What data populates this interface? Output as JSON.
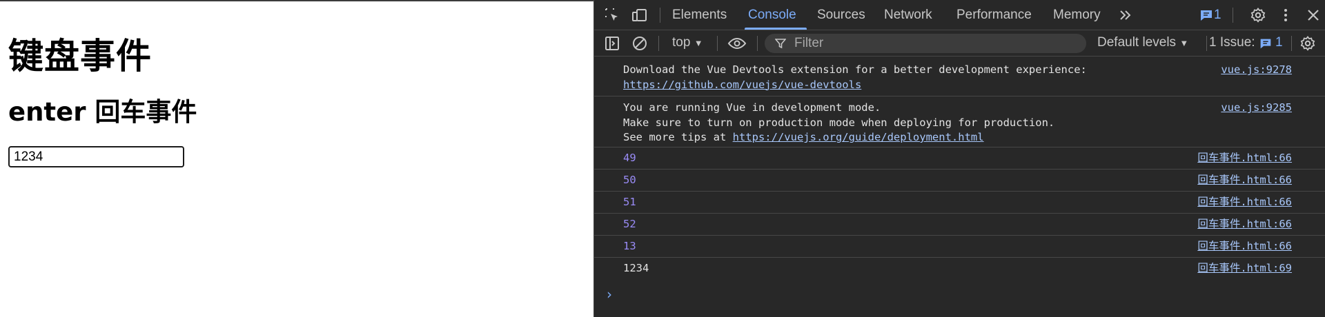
{
  "page": {
    "heading": "键盘事件",
    "subheading": "enter 回车事件",
    "input_value": "1234"
  },
  "devtools": {
    "tabs": [
      "Elements",
      "Console",
      "Sources",
      "Network",
      "Performance",
      "Memory"
    ],
    "active_tab": "Console",
    "issues_badge_count": "1",
    "toolbar": {
      "context": "top",
      "filter_placeholder": "Filter",
      "levels": "Default levels",
      "issues_label": "1 Issue:",
      "issues_count": "1"
    },
    "messages": [
      {
        "lines": [
          "Download the Vue Devtools extension for a better development experience:"
        ],
        "link": "https://github.com/vuejs/vue-devtools",
        "source": "vue.js:9278"
      },
      {
        "lines": [
          "You are running Vue in development mode.",
          "Make sure to turn on production mode when deploying for production.",
          "See more tips at "
        ],
        "link": "https://vuejs.org/guide/deployment.html",
        "source": "vue.js:9285"
      },
      {
        "text": "49",
        "source": "回车事件.html:66"
      },
      {
        "text": "50",
        "source": "回车事件.html:66"
      },
      {
        "text": "51",
        "source": "回车事件.html:66"
      },
      {
        "text": "52",
        "source": "回车事件.html:66"
      },
      {
        "text": "13",
        "source": "回车事件.html:66"
      },
      {
        "text": "1234",
        "source": "回车事件.html:69"
      }
    ],
    "prompt_icon": "chevron-right-icon"
  }
}
